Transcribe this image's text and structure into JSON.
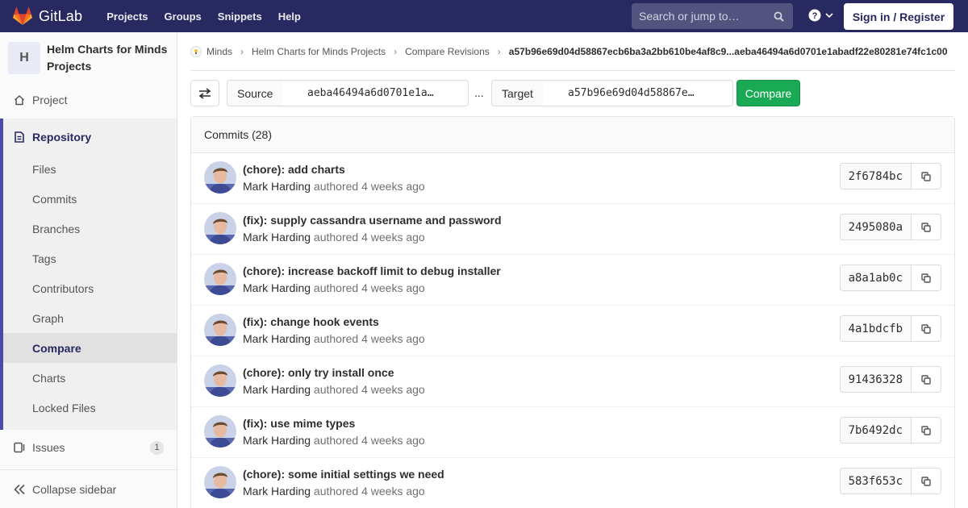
{
  "navbar": {
    "brand": "GitLab",
    "links": [
      "Projects",
      "Groups",
      "Snippets",
      "Help"
    ],
    "search_placeholder": "Search or jump to…",
    "signin_label": "Sign in / Register",
    "colors": {
      "background": "#292961",
      "logo": "#e24329"
    }
  },
  "sidebar": {
    "project_initial": "H",
    "project_name": "Helm Charts for Minds Projects",
    "project_label": "Project",
    "repository_label": "Repository",
    "repository_items": [
      "Files",
      "Commits",
      "Branches",
      "Tags",
      "Contributors",
      "Graph",
      "Compare",
      "Charts",
      "Locked Files"
    ],
    "active_item": "Compare",
    "issues_label": "Issues",
    "issues_count": "1",
    "collapse_label": "Collapse sidebar"
  },
  "breadcrumb": {
    "items": [
      "Minds",
      "Helm Charts for Minds Projects",
      "Compare Revisions"
    ],
    "current": "a57b96e69d04d58867ecb6ba3a2bb610be4af8c9...aeba46494a6d0701e1abadf22e80281e74fc1c00"
  },
  "compare": {
    "source_label": "Source",
    "source_value": "aeba46494a6d0701e1a…",
    "separator": "...",
    "target_label": "Target",
    "target_value": "a57b96e69d04d58867e…",
    "button_label": "Compare",
    "button_color": "#1aaa55"
  },
  "commits": {
    "header": "Commits (28)",
    "authored_text": "authored",
    "rows": [
      {
        "title": "(chore): add charts",
        "author": "Mark Harding",
        "time": "4 weeks ago",
        "sha": "2f6784bc"
      },
      {
        "title": "(fix): supply cassandra username and password",
        "author": "Mark Harding",
        "time": "4 weeks ago",
        "sha": "2495080a"
      },
      {
        "title": "(chore): increase backoff limit to debug installer",
        "author": "Mark Harding",
        "time": "4 weeks ago",
        "sha": "a8a1ab0c"
      },
      {
        "title": "(fix): change hook events",
        "author": "Mark Harding",
        "time": "4 weeks ago",
        "sha": "4a1bdcfb"
      },
      {
        "title": "(chore): only try install once",
        "author": "Mark Harding",
        "time": "4 weeks ago",
        "sha": "91436328"
      },
      {
        "title": "(fix): use mime types",
        "author": "Mark Harding",
        "time": "4 weeks ago",
        "sha": "7b6492dc"
      },
      {
        "title": "(chore): some initial settings we need",
        "author": "Mark Harding",
        "time": "4 weeks ago",
        "sha": "583f653c"
      }
    ]
  }
}
